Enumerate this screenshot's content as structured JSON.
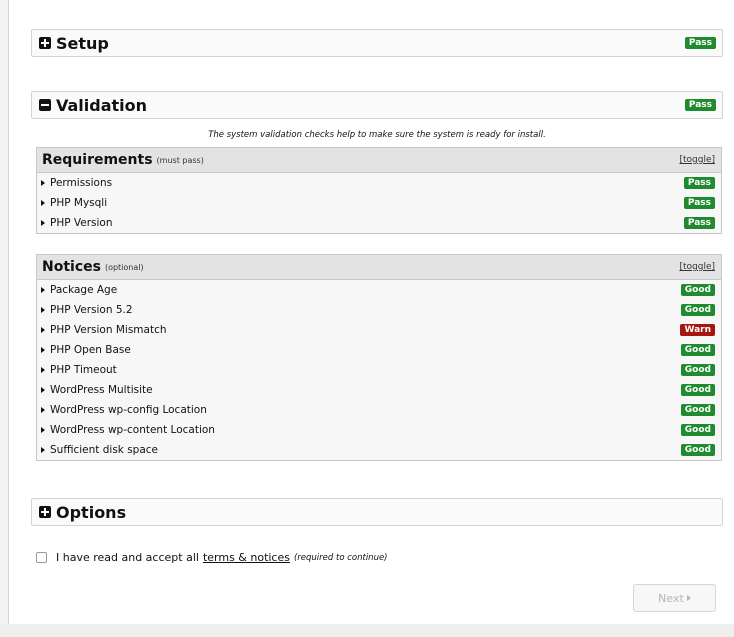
{
  "setup": {
    "title": "Setup",
    "badge": "Pass"
  },
  "validation": {
    "title": "Validation",
    "badge": "Pass",
    "intro": "The system validation checks help to make sure the system is ready for install."
  },
  "requirements": {
    "title": "Requirements",
    "subtitle": "(must pass)",
    "toggle": "[toggle]",
    "items": [
      {
        "label": "Permissions",
        "status": "Pass"
      },
      {
        "label": "PHP Mysqli",
        "status": "Pass"
      },
      {
        "label": "PHP Version",
        "status": "Pass"
      }
    ]
  },
  "notices": {
    "title": "Notices",
    "subtitle": "(optional)",
    "toggle": "[toggle]",
    "items": [
      {
        "label": "Package Age",
        "status": "Good"
      },
      {
        "label": "PHP Version 5.2",
        "status": "Good"
      },
      {
        "label": "PHP Version Mismatch",
        "status": "Warn"
      },
      {
        "label": "PHP Open Base",
        "status": "Good"
      },
      {
        "label": "PHP Timeout",
        "status": "Good"
      },
      {
        "label": "WordPress Multisite",
        "status": "Good"
      },
      {
        "label": "WordPress wp-config Location",
        "status": "Good"
      },
      {
        "label": "WordPress wp-content Location",
        "status": "Good"
      },
      {
        "label": "Sufficient disk space",
        "status": "Good"
      }
    ]
  },
  "options": {
    "title": "Options"
  },
  "accept": {
    "text": "I have read and accept all",
    "link": "terms & notices",
    "note": "(required to continue)"
  },
  "next_button": {
    "label": "Next"
  },
  "colors": {
    "pass": "#1f8a2e",
    "warn": "#a4160e"
  }
}
